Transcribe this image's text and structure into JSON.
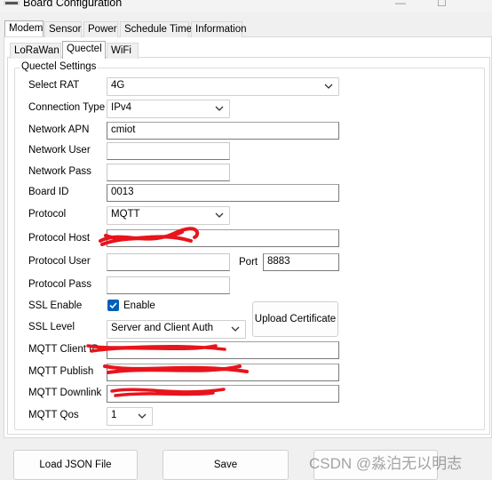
{
  "window": {
    "title": "Board Configuration",
    "minimize_glyph": "—",
    "maximize_glyph": "☐"
  },
  "outer_tabs": [
    "Modem",
    "Sensor",
    "Power",
    "Schedule Time",
    "Information"
  ],
  "inner_tabs": [
    "LoRaWan",
    "Quectel",
    "WiFi"
  ],
  "group_title": "Quectel Settings",
  "fields": {
    "select_rat": {
      "label": "Select RAT",
      "value": "4G"
    },
    "connection_type": {
      "label": "Connection Type",
      "value": "IPv4"
    },
    "network_apn": {
      "label": "Network APN",
      "value": "cmiot"
    },
    "network_user": {
      "label": "Network User",
      "value": ""
    },
    "network_pass": {
      "label": "Network Pass",
      "value": ""
    },
    "board_id": {
      "label": "Board ID",
      "value": "0013"
    },
    "protocol": {
      "label": "Protocol",
      "value": "MQTT"
    },
    "protocol_host": {
      "label": "Protocol Host",
      "value": ""
    },
    "protocol_user": {
      "label": "Protocol User",
      "value": ""
    },
    "port": {
      "label": "Port",
      "value": "8883"
    },
    "protocol_pass": {
      "label": "Protocol Pass",
      "value": ""
    },
    "ssl_enable": {
      "label": "SSL Enable",
      "checkbox_label": "Enable",
      "checked": true
    },
    "ssl_level": {
      "label": "SSL Level",
      "value": "Server and Client Auth"
    },
    "mqtt_client_id": {
      "label": "MQTT Client ID",
      "value": ""
    },
    "mqtt_publish": {
      "label": "MQTT Publish",
      "value": ""
    },
    "mqtt_downlink": {
      "label": "MQTT Downlink",
      "value": ""
    },
    "mqtt_qos": {
      "label": "MQTT Qos",
      "value": "1"
    }
  },
  "buttons": {
    "upload_certificate": "Upload Certificate",
    "load_json": "Load JSON File",
    "save": "Save"
  },
  "watermark": "CSDN @淼泊无以明志",
  "colors": {
    "accent": "#005fb8",
    "redaction": "#e8141c"
  }
}
